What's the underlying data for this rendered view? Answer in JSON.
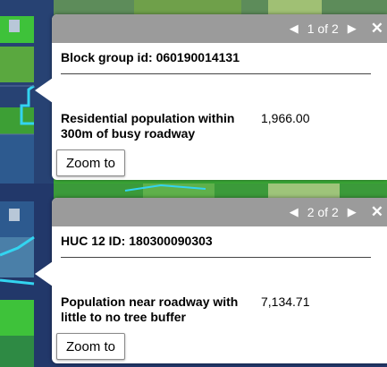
{
  "popups": [
    {
      "pager": {
        "current": 1,
        "total": 2,
        "text": "1 of 2"
      },
      "title_label": "Block group id:",
      "title_value": "060190014131",
      "attribute": {
        "label": "Residential population within 300m of busy roadway",
        "value": "1,966.00"
      },
      "zoom_label": "Zoom to"
    },
    {
      "pager": {
        "current": 2,
        "total": 2,
        "text": "2 of 2"
      },
      "title_label": "HUC 12 ID:",
      "title_value": "180300090303",
      "attribute": {
        "label": "Population near roadway with little to no tree buffer",
        "value": "7,134.71"
      },
      "zoom_label": "Zoom to"
    }
  ],
  "icons": {
    "prev": "triangle-left-icon",
    "next": "triangle-right-icon",
    "close": "close-icon"
  },
  "colors": {
    "popup_header": "#9b9b9b",
    "map_water": "#2a3f6e",
    "map_green": "#46b83c",
    "map_highlight": "#33d4f0"
  }
}
